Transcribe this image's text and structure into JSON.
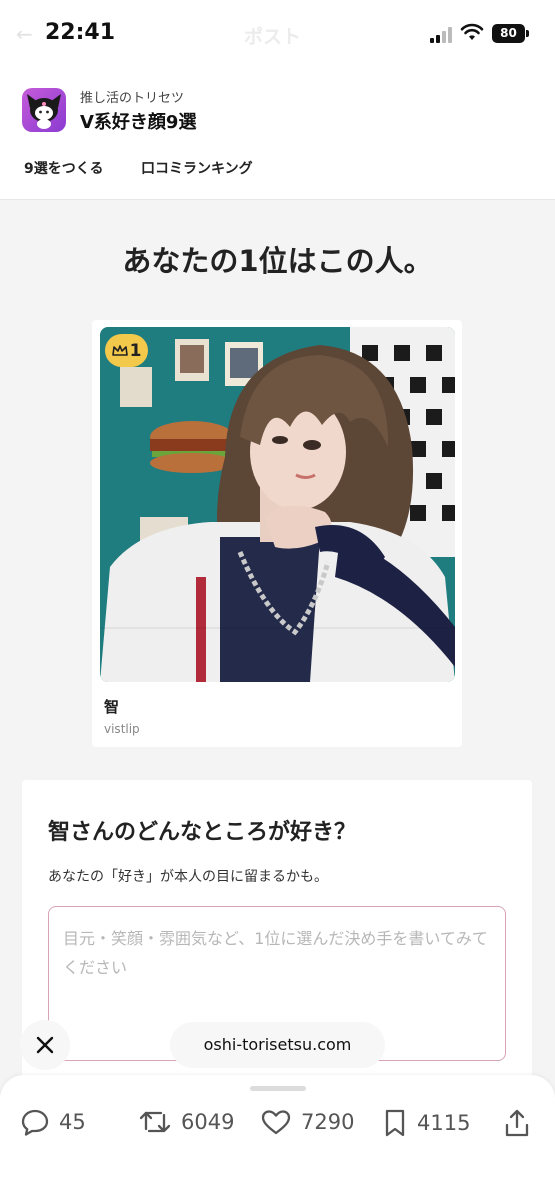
{
  "status_bar": {
    "time": "22:41",
    "ghost_title": "ポスト",
    "battery": "80",
    "icons": [
      "signal-icon",
      "wifi-icon",
      "battery-icon"
    ]
  },
  "app": {
    "icon": "kuromi-app-icon",
    "subtitle": "推し活のトリセツ",
    "title": "V系好き顔9選",
    "nav": [
      "9選をつくる",
      "口コミランキング"
    ]
  },
  "result": {
    "headline": "あなたの1位はこの人。",
    "rank": "1",
    "name": "智",
    "group": "vistlip"
  },
  "comment_form": {
    "title": "智さんのどんなところが好き？",
    "description": "あなたの「好き」が本人の目に留まるかも。",
    "placeholder": "目元・笑顔・雰囲気など、1位に選んだ決め手を書いてみてください"
  },
  "browser_overlay": {
    "url": "oshi-torisetsu.com"
  },
  "actions": {
    "replies": "45",
    "reposts": "6049",
    "likes": "7290",
    "bookmarks": "4115"
  },
  "colors": {
    "badge": "#f3c94c",
    "textarea_border": "#d8a4b2",
    "app_icon": "#b04fd8"
  }
}
